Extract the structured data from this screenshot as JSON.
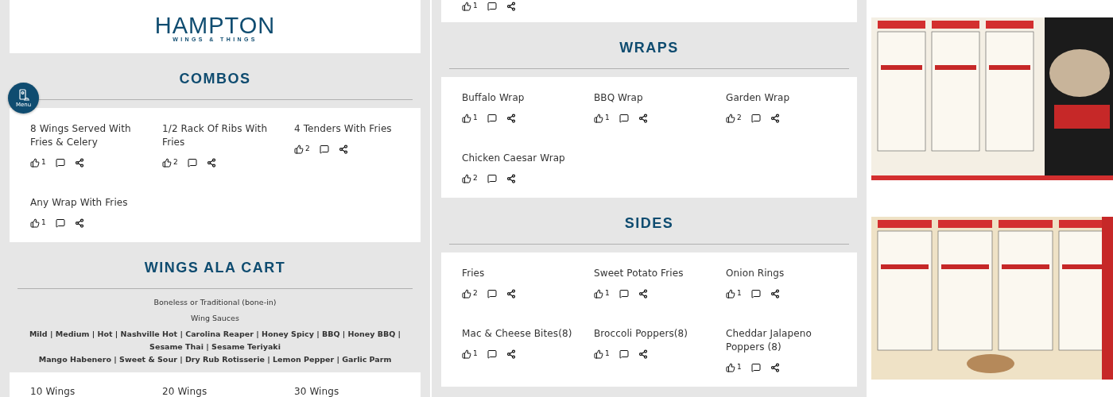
{
  "menu_button": {
    "label": "Menu"
  },
  "left_column": {
    "logo": {
      "name": "HAMPTON",
      "tagline": "WINGS & THINGS"
    },
    "sections": [
      {
        "title": "COMBOS",
        "items": [
          {
            "name": "8 Wings Served With Fries & Celery",
            "likes": "1"
          },
          {
            "name": "1/2 Rack Of Ribs With Fries",
            "likes": "2"
          },
          {
            "name": "4 Tenders With Fries",
            "likes": "2"
          },
          {
            "name": "Any Wrap With Fries",
            "likes": "1"
          }
        ]
      },
      {
        "title": "WINGS ALA CART",
        "notes": [
          {
            "kind": "plain",
            "text": "Boneless or Traditional (bone-in)"
          },
          {
            "kind": "plain",
            "text": "Wing Sauces"
          },
          {
            "kind": "bold",
            "text": "Mild | Medium | Hot | Nashville Hot | Carolina Reaper | Honey Spicy | BBQ | Honey BBQ | Sesame Thai | Sesame Teriyaki"
          },
          {
            "kind": "bold",
            "text": "Mango Habenero | Sweet & Sour | Dry Rub Rotisserie | Lemon Pepper | Garlic Parm"
          }
        ],
        "items": [
          {
            "name": "10 Wings"
          },
          {
            "name": "20 Wings"
          },
          {
            "name": "30 Wings"
          }
        ]
      }
    ]
  },
  "middle_column": {
    "top_card": {
      "items": [
        {
          "likes": "1"
        }
      ]
    },
    "sections": [
      {
        "title": "WRAPS",
        "items": [
          {
            "name": "Buffalo Wrap",
            "likes": "1"
          },
          {
            "name": "BBQ Wrap",
            "likes": "1"
          },
          {
            "name": "Garden Wrap",
            "likes": "2"
          },
          {
            "name": "Chicken Caesar Wrap",
            "likes": "2"
          }
        ]
      },
      {
        "title": "SIDES",
        "items": [
          {
            "name": "Fries",
            "likes": "2"
          },
          {
            "name": "Sweet Potato Fries",
            "likes": "1"
          },
          {
            "name": "Onion Rings",
            "likes": "1"
          },
          {
            "name": "Mac & Cheese Bites(8)",
            "likes": "1"
          },
          {
            "name": "Broccoli Poppers(8)",
            "likes": "1"
          },
          {
            "name": "Cheddar Jalapeno Poppers (8)",
            "likes": "1"
          }
        ]
      }
    ]
  }
}
